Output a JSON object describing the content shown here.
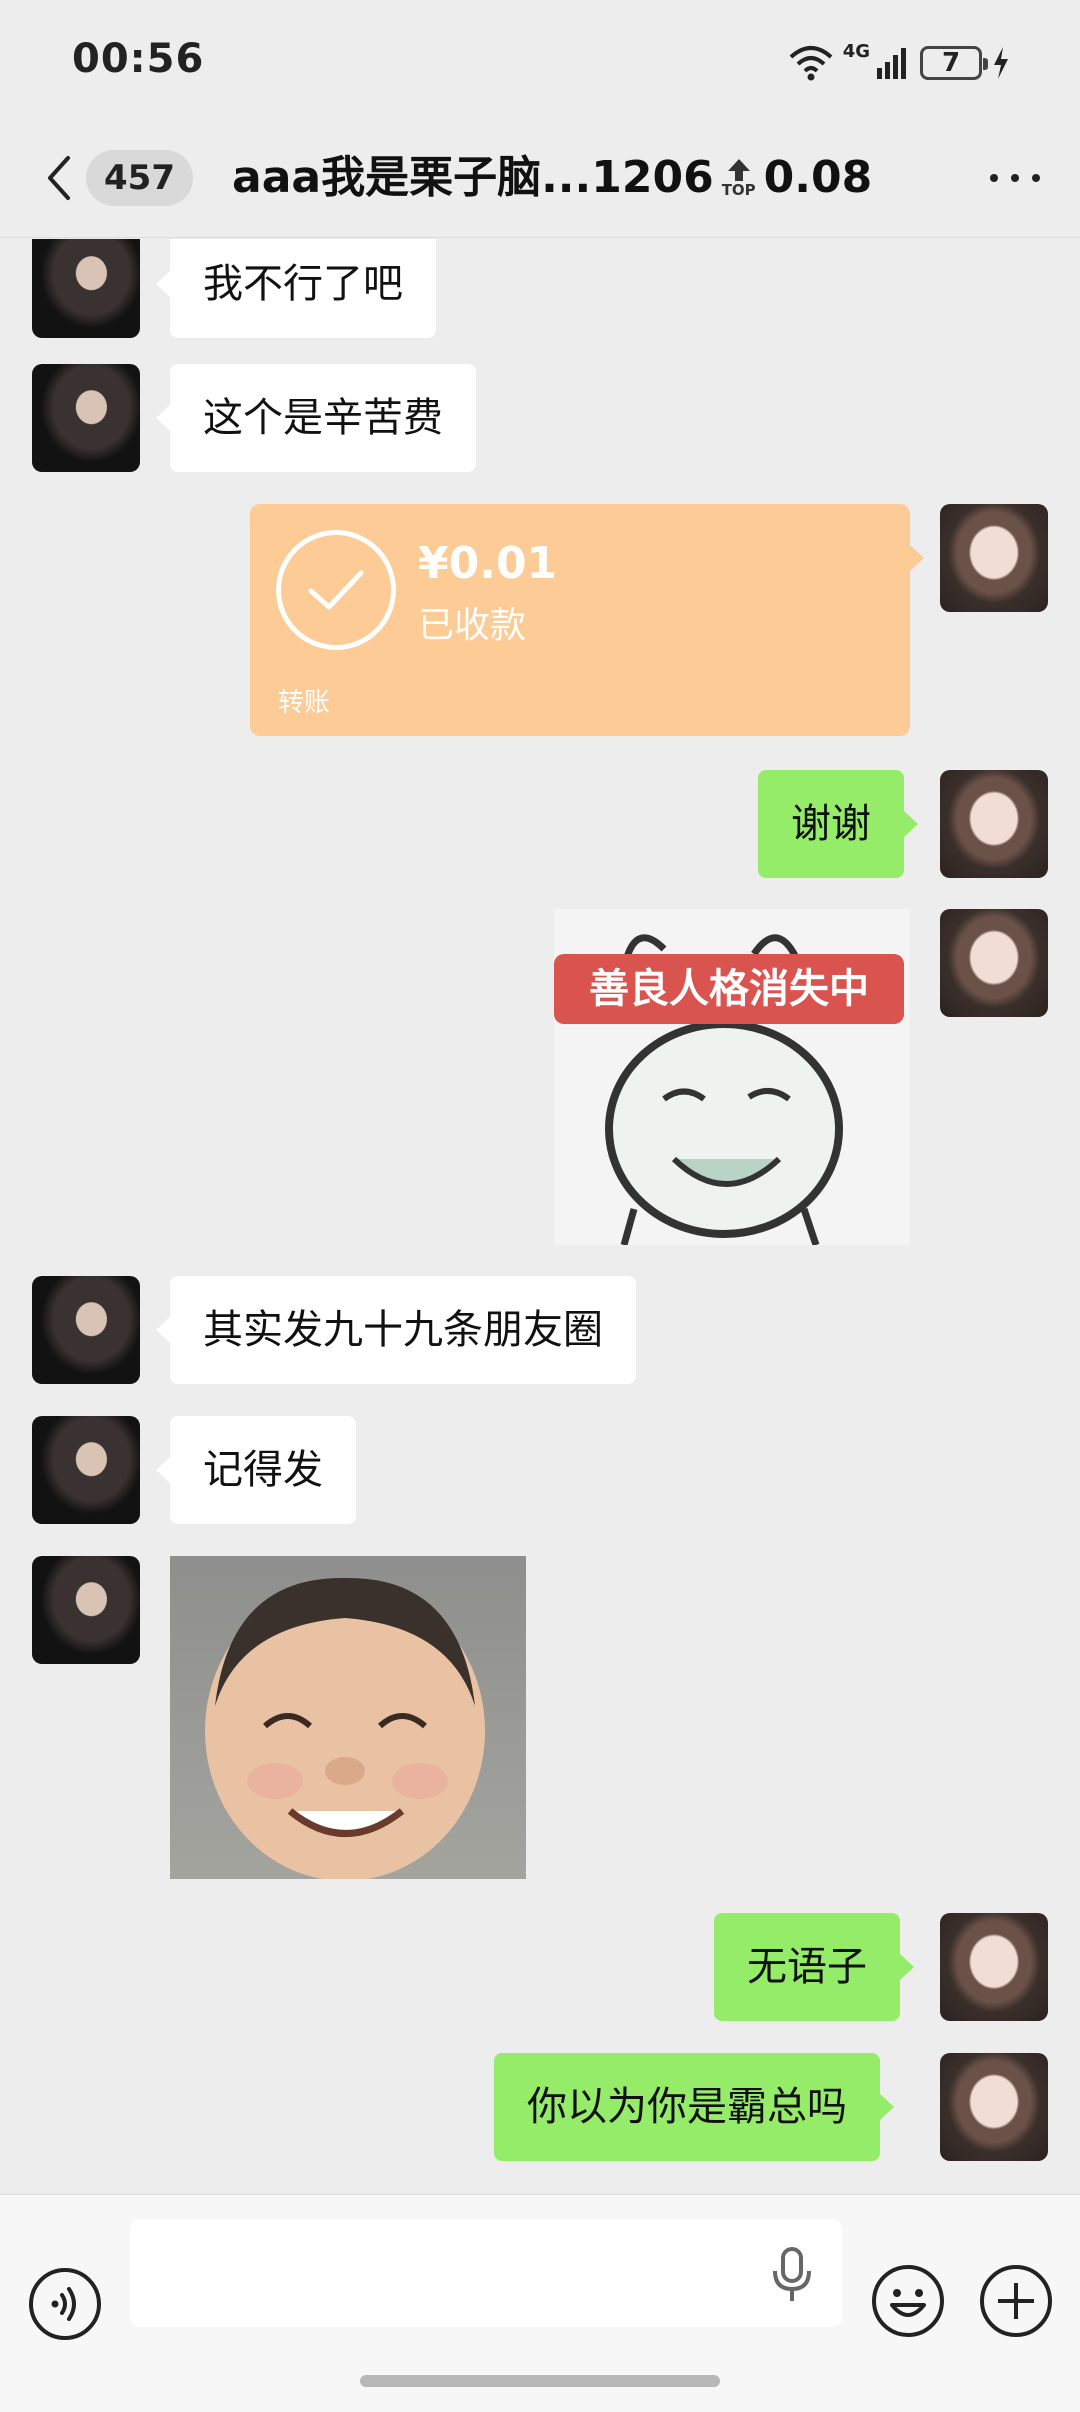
{
  "status_bar": {
    "time": "00:56",
    "network": "4G",
    "battery": "7"
  },
  "nav": {
    "unread_count": "457",
    "title": "aaa我是栗子脑...1206",
    "top_label": "TOP",
    "title_suffix": "0.08"
  },
  "messages": [
    {
      "side": "left",
      "type": "text",
      "text": "我不行了吧"
    },
    {
      "side": "left",
      "type": "text",
      "text": "这个是辛苦费"
    },
    {
      "side": "right",
      "type": "transfer",
      "amount": "¥0.01",
      "status": "已收款",
      "label": "转账"
    },
    {
      "side": "right",
      "type": "text",
      "text": "谢谢"
    },
    {
      "side": "right",
      "type": "sticker",
      "caption": "善良人格消失中"
    },
    {
      "side": "left",
      "type": "text",
      "text": "其实发九十九条朋友圈"
    },
    {
      "side": "left",
      "type": "text",
      "text": "记得发"
    },
    {
      "side": "left",
      "type": "sticker",
      "caption": ""
    },
    {
      "side": "right",
      "type": "text",
      "text": "无语子"
    },
    {
      "side": "right",
      "type": "text",
      "text": "你以为你是霸总吗"
    }
  ],
  "input": {
    "placeholder": ""
  },
  "colors": {
    "background": "#ededed",
    "sent_bubble": "#95ec69",
    "received_bubble": "#ffffff",
    "transfer_card": "#fccb96",
    "meme_banner": "#d9534f"
  }
}
